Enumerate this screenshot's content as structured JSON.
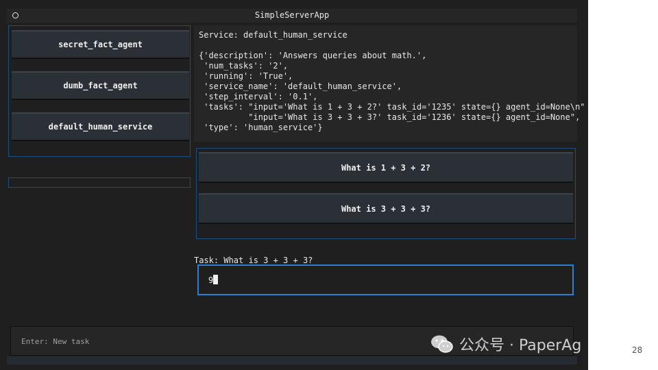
{
  "window": {
    "title": "SimpleServerApp"
  },
  "sidebar": {
    "items": [
      {
        "label": "secret_fact_agent"
      },
      {
        "label": "dumb_fact_agent"
      },
      {
        "label": "default_human_service"
      }
    ]
  },
  "service": {
    "heading": "Service: default_human_service",
    "details": "{'description': 'Answers queries about math.',\n 'num_tasks': '2',\n 'running': 'True',\n 'service_name': 'default_human_service',\n 'step_interval': '0.1',\n 'tasks': \"input='What is 1 + 3 + 2?' task_id='1235' state={} agent_id=None\\n\"\n          \"input='What is 3 + 3 + 3?' task_id='1236' state={} agent_id=None\",\n 'type': 'human_service'}"
  },
  "tasks": {
    "items": [
      {
        "label": "What is 1 + 3 + 2?"
      },
      {
        "label": "What is 3 + 3 + 3?"
      }
    ]
  },
  "current_task": {
    "label": "Task: What is 3 + 3 + 3?",
    "answer_value": "9"
  },
  "footer": {
    "placeholder": "Enter: New task"
  },
  "watermark": {
    "text": "公众号 · PaperAgent"
  },
  "page_number": "28"
}
